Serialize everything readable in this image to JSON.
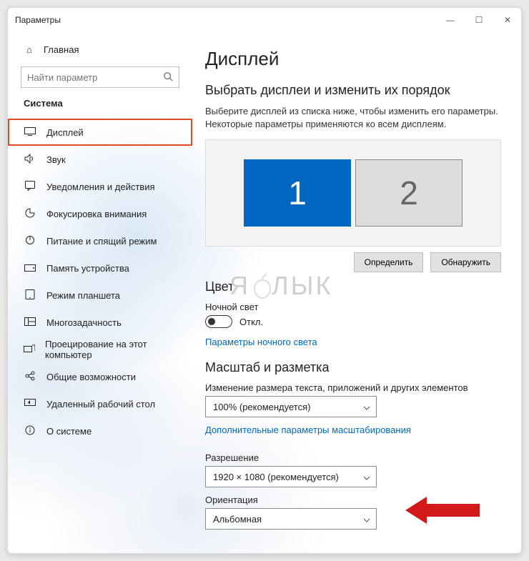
{
  "titlebar": {
    "title": "Параметры"
  },
  "home_label": "Главная",
  "search": {
    "placeholder": "Найти параметр"
  },
  "section_label": "Система",
  "nav": {
    "items": [
      {
        "label": "Дисплей"
      },
      {
        "label": "Звук"
      },
      {
        "label": "Уведомления и действия"
      },
      {
        "label": "Фокусировка внимания"
      },
      {
        "label": "Питание и спящий режим"
      },
      {
        "label": "Память устройства"
      },
      {
        "label": "Режим планшета"
      },
      {
        "label": "Многозадачность"
      },
      {
        "label": "Проецирование на этот компьютер"
      },
      {
        "label": "Общие возможности"
      },
      {
        "label": "Удаленный рабочий стол"
      },
      {
        "label": "О системе"
      }
    ]
  },
  "content": {
    "page_title": "Дисплей",
    "arrange_heading": "Выбрать дисплеи и изменить их порядок",
    "arrange_desc": "Выберите дисплей из списка ниже, чтобы изменить его параметры. Некоторые параметры применяются ко всем дисплеям.",
    "monitors": {
      "primary": "1",
      "secondary": "2"
    },
    "identify_btn": "Определить",
    "detect_btn": "Обнаружить",
    "color_heading": "Цвет",
    "night_light_label": "Ночной свет",
    "night_light_state": "Откл.",
    "night_light_link": "Параметры ночного света",
    "scale_heading": "Масштаб и разметка",
    "scale_label": "Изменение размера текста, приложений и других элементов",
    "scale_value": "100% (рекомендуется)",
    "scale_link": "Дополнительные параметры масштабирования",
    "resolution_label": "Разрешение",
    "resolution_value": "1920 × 1080 (рекомендуется)",
    "orientation_label": "Ориентация",
    "orientation_value": "Альбомная"
  },
  "watermark": "ЯБЛЫК",
  "colors": {
    "accent": "#0067c0",
    "highlight_box": "#e04a27",
    "arrow": "#d31919"
  }
}
